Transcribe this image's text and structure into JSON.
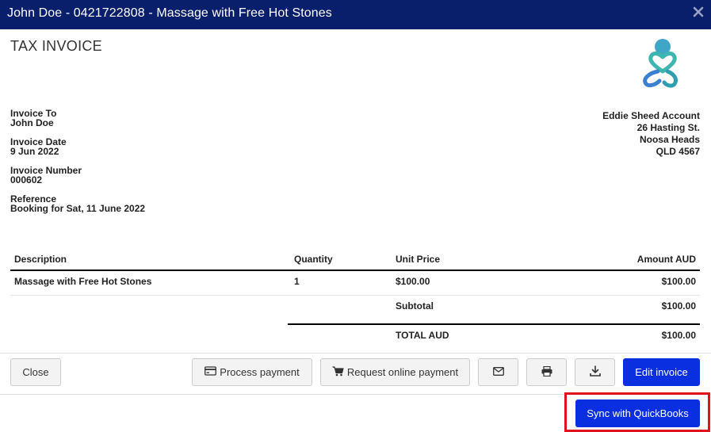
{
  "window": {
    "title": "John Doe - 0421722808 - Massage with Free Hot Stones"
  },
  "invoice": {
    "heading": "TAX INVOICE",
    "fields": [
      {
        "label": "Invoice To",
        "value": "John Doe"
      },
      {
        "label": "Invoice Date",
        "value": "9 Jun 2022"
      },
      {
        "label": "Invoice Number",
        "value": "000602"
      },
      {
        "label": "Reference",
        "value": "Booking for Sat, 11 June 2022"
      }
    ],
    "address": [
      "Eddie Sheed Account",
      "26 Hasting St.",
      "Noosa Heads",
      "QLD 4567"
    ]
  },
  "table": {
    "headers": {
      "description": "Description",
      "quantity": "Quantity",
      "unit_price": "Unit Price",
      "amount": "Amount AUD"
    },
    "rows": [
      {
        "description": "Massage with Free Hot Stones",
        "quantity": "1",
        "unit_price": "$100.00",
        "amount": "$100.00"
      }
    ],
    "subtotal_label": "Subtotal",
    "subtotal_value": "$100.00",
    "total_label": "TOTAL AUD",
    "total_value": "$100.00"
  },
  "actions": {
    "close": "Close",
    "process_payment": "Process payment",
    "request_online_payment": "Request online payment",
    "edit_invoice": "Edit invoice",
    "sync_quickbooks": "Sync with QuickBooks"
  },
  "icons": {
    "close": "close-icon",
    "process_payment": "credit-card-icon",
    "request_online_payment": "cart-icon",
    "email": "envelope-icon",
    "print": "printer-icon",
    "download": "download-icon",
    "logo": "brand-logo-icon"
  },
  "colors": {
    "titlebar": "#0a1f6b",
    "primary": "#0a2fe0",
    "highlight": "#e0131c",
    "logo_teal": "#3fb5b0",
    "logo_blue": "#3a7fd0"
  }
}
